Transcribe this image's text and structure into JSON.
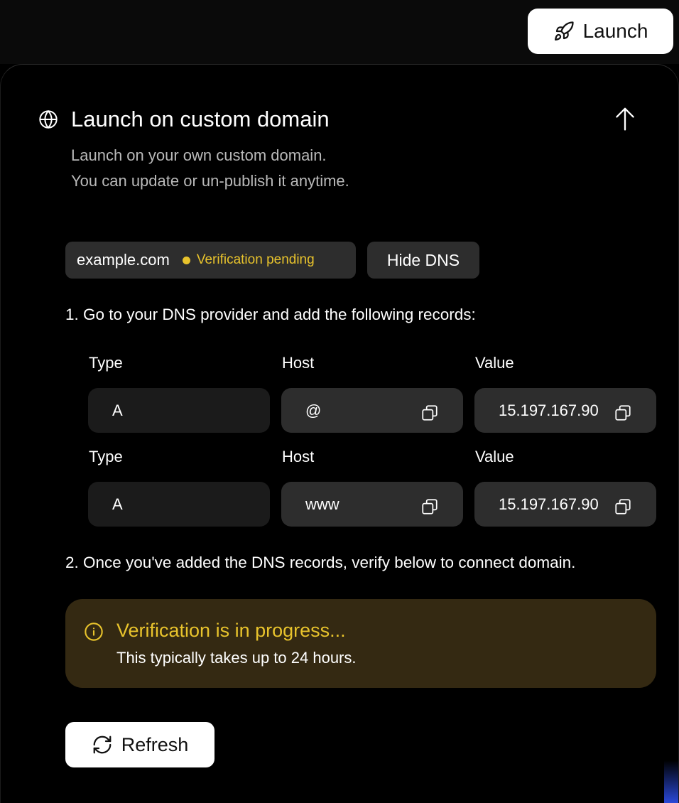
{
  "topbar": {
    "launch_label": "Launch",
    "launch_icon": "rocket-icon"
  },
  "section": {
    "icon": "globe-icon",
    "title": "Launch on custom domain",
    "subtitle_line1": "Launch on your own custom domain.",
    "subtitle_line2": "You can update or un-publish it anytime.",
    "collapse_icon": "arrow-up-icon"
  },
  "domain": {
    "name": "example.com",
    "status": "Verification pending",
    "status_color": "#e8c32c",
    "hide_dns_label": "Hide DNS"
  },
  "steps": {
    "step1": "1. Go to your DNS provider and add the following records:",
    "step2": "2. Once you've added the DNS records, verify below to connect domain."
  },
  "dns_records": [
    {
      "type_label": "Type",
      "host_label": "Host",
      "value_label": "Value",
      "type": "A",
      "host": "@",
      "value": "15.197.167.90"
    },
    {
      "type_label": "Type",
      "host_label": "Host",
      "value_label": "Value",
      "type": "A",
      "host": "www",
      "value": "15.197.167.90"
    }
  ],
  "notice": {
    "icon": "info-icon",
    "title": "Verification is in progress...",
    "subtitle": "This typically takes up to 24 hours.",
    "accent_color": "#e8c32c",
    "background_color": "#342912"
  },
  "refresh": {
    "label": "Refresh",
    "icon": "refresh-icon"
  }
}
